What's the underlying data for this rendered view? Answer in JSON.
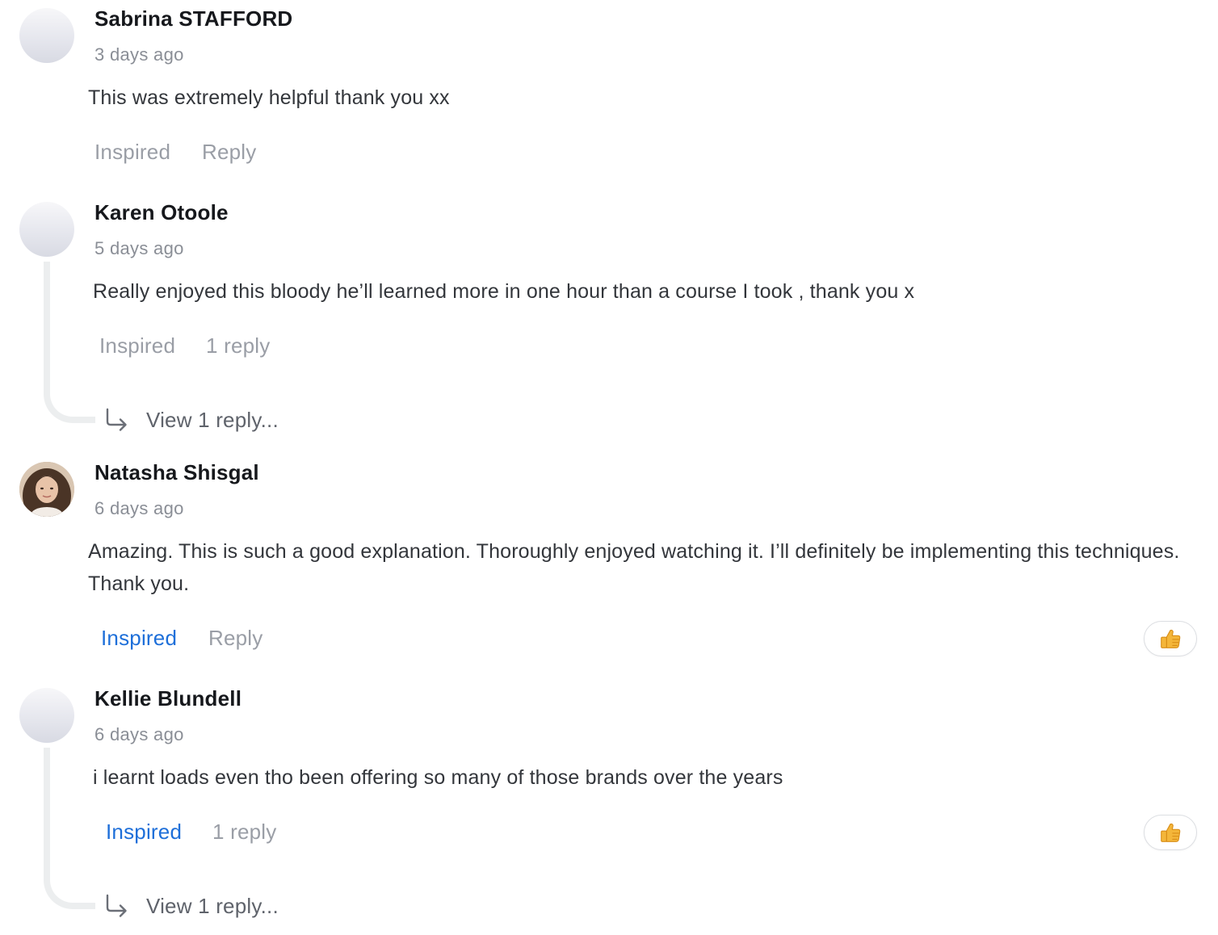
{
  "comments": [
    {
      "author": "Sabrina STAFFORD",
      "time": "3 days ago",
      "text": "This was extremely helpful thank you xx",
      "inspired_label": "Inspired",
      "second_action": "Reply",
      "inspired_active": false,
      "has_reaction": false,
      "avatar": "placeholder"
    },
    {
      "author": "Karen Otoole",
      "time": "5 days ago",
      "text": "Really enjoyed this bloody he’ll learned more in one hour than a course I took , thank you x",
      "inspired_label": "Inspired",
      "second_action": "1 reply",
      "inspired_active": false,
      "has_reaction": false,
      "avatar": "placeholder",
      "view_replies": "View 1 reply..."
    },
    {
      "author": "Natasha Shisgal",
      "time": "6 days ago",
      "text": "Amazing. This is such a good explanation. Thoroughly enjoyed watching it. I’ll definitely be implementing this techniques. Thank you.",
      "inspired_label": "Inspired",
      "second_action": "Reply",
      "inspired_active": true,
      "has_reaction": true,
      "reaction_icon": "thumbs-up-icon",
      "avatar": "photo"
    },
    {
      "author": "Kellie Blundell",
      "time": "6 days ago",
      "text": "i learnt loads even tho been offering so many of those brands over the years",
      "inspired_label": "Inspired",
      "second_action": "1 reply",
      "inspired_active": true,
      "has_reaction": true,
      "reaction_icon": "thumbs-up-icon",
      "avatar": "placeholder",
      "view_replies": "View 1 reply..."
    }
  ],
  "colors": {
    "inspired_active": "#1e6fd9",
    "action_inactive": "#9a9ea6",
    "thread_line": "#eceeef",
    "reaction_thumb": "#f4b63a"
  }
}
